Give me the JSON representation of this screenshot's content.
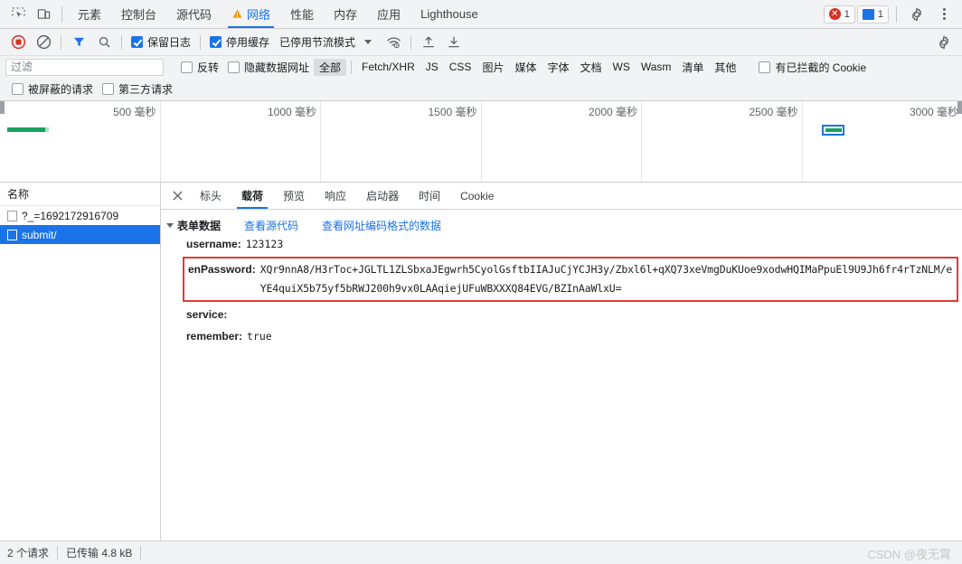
{
  "tabstrip": {
    "inspect_icon": "inspect-element-icon",
    "device_icon": "device-toolbar-icon",
    "tabs": [
      {
        "label": "元素",
        "selected": false,
        "warn": false
      },
      {
        "label": "控制台",
        "selected": false,
        "warn": false
      },
      {
        "label": "源代码",
        "selected": false,
        "warn": false
      },
      {
        "label": "网络",
        "selected": true,
        "warn": true
      },
      {
        "label": "性能",
        "selected": false,
        "warn": false
      },
      {
        "label": "内存",
        "selected": false,
        "warn": false
      },
      {
        "label": "应用",
        "selected": false,
        "warn": false
      },
      {
        "label": "Lighthouse",
        "selected": false,
        "warn": false
      }
    ],
    "error_count": "1",
    "message_count": "1",
    "settings_icon": "gear-icon",
    "more_icon": "kebab-menu-icon",
    "accent": "#1a73e8",
    "error_color": "#d93025"
  },
  "toolbar": {
    "record_icon": "record-stop-icon",
    "clear_icon": "clear-network-icon",
    "filter_icon": "filter-funnel-icon",
    "search_icon": "search-icon",
    "preserve_log_label": "保留日志",
    "preserve_log_checked": true,
    "disable_cache_label": "停用缓存",
    "disable_cache_checked": true,
    "throttle_label": "已停用节流模式",
    "wifi_icon": "network-conditions-icon",
    "import_icon": "import-har-icon",
    "export_icon": "export-har-icon",
    "settings_icon": "network-settings-gear-icon"
  },
  "filters": {
    "placeholder": "过滤",
    "value": "",
    "invert_label": "反转",
    "invert_checked": false,
    "hide_data_urls_label": "隐藏数据网址",
    "hide_data_urls_checked": false,
    "types": [
      {
        "label": "全部",
        "selected": true
      },
      {
        "label": "Fetch/XHR",
        "selected": false
      },
      {
        "label": "JS",
        "selected": false
      },
      {
        "label": "CSS",
        "selected": false
      },
      {
        "label": "图片",
        "selected": false
      },
      {
        "label": "媒体",
        "selected": false
      },
      {
        "label": "字体",
        "selected": false
      },
      {
        "label": "文档",
        "selected": false
      },
      {
        "label": "WS",
        "selected": false
      },
      {
        "label": "Wasm",
        "selected": false
      },
      {
        "label": "清单",
        "selected": false
      },
      {
        "label": "其他",
        "selected": false
      }
    ],
    "blocked_cookies_label": "有已拦截的 Cookie",
    "blocked_cookies_checked": false,
    "blocked_requests_label": "被屏蔽的请求",
    "blocked_requests_checked": false,
    "third_party_label": "第三方请求",
    "third_party_checked": false
  },
  "overview": {
    "ticks": [
      "500 毫秒",
      "1000 毫秒",
      "1500 毫秒",
      "2000 毫秒",
      "2500 毫秒",
      "3000 毫秒"
    ],
    "bar_color": "#1aa260",
    "selection_color": "#1a73e8"
  },
  "request_list": {
    "column_header": "名称",
    "rows": [
      {
        "name": "?_=1692172916709",
        "selected": false
      },
      {
        "name": "submit/",
        "selected": true
      }
    ]
  },
  "detail": {
    "close_icon": "close-icon",
    "tabs": [
      {
        "label": "标头",
        "selected": false
      },
      {
        "label": "载荷",
        "selected": true
      },
      {
        "label": "预览",
        "selected": false
      },
      {
        "label": "响应",
        "selected": false
      },
      {
        "label": "启动器",
        "selected": false
      },
      {
        "label": "时间",
        "selected": false
      },
      {
        "label": "Cookie",
        "selected": false
      }
    ],
    "section_title": "表单数据",
    "view_source_link": "查看源代码",
    "view_urlencoded_link": "查看网址编码格式的数据",
    "fields": [
      {
        "key": "username:",
        "value": "123123",
        "highlighted": false
      },
      {
        "key": "enPassword:",
        "value": "XQr9nnA8/H3rToc+JGLTL1ZLSbxaJEgwrh5CyolGsftbIIAJuCjYCJH3y/Zbxl6l+qXQ73xeVmgDuKUoe9xodwHQIMaPpuEl9U9Jh6fr4rTzNLM/eYE4quiX5b75yf5bRWJ200h9vx0LAAqiejUFuWBXXXQ84EVG/BZInAaWlxU=",
        "highlighted": true,
        "highlight_color": "#e53935"
      },
      {
        "key": "service:",
        "value": "",
        "highlighted": false
      },
      {
        "key": "remember:",
        "value": "true",
        "highlighted": false
      }
    ]
  },
  "statusbar": {
    "requests": "2 个请求",
    "transferred": "已传输 4.8 kB",
    "watermark": "CSDN @夜无霄"
  }
}
